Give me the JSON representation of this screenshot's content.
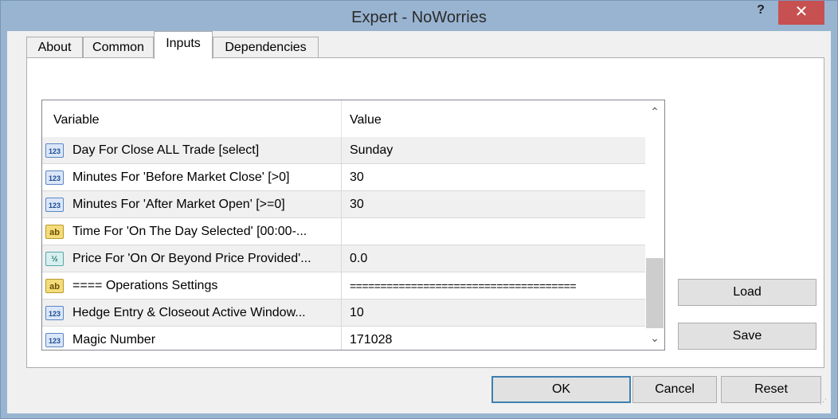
{
  "window": {
    "title": "Expert - NoWorries",
    "help_label": "?",
    "close_label": "✕"
  },
  "tabs": [
    {
      "label": "About",
      "active": false
    },
    {
      "label": "Common",
      "active": false
    },
    {
      "label": "Inputs",
      "active": true
    },
    {
      "label": "Dependencies",
      "active": false
    }
  ],
  "grid": {
    "columns": [
      "Variable",
      "Value"
    ],
    "rows": [
      {
        "icon": "integer-type-icon",
        "icon_text": "123",
        "variable": "Day For Close ALL Trade [select]",
        "value": "Sunday"
      },
      {
        "icon": "integer-type-icon",
        "icon_text": "123",
        "variable": "Minutes For 'Before Market Close' [>0]",
        "value": "30"
      },
      {
        "icon": "integer-type-icon",
        "icon_text": "123",
        "variable": "Minutes For 'After Market Open' [>=0]",
        "value": "30"
      },
      {
        "icon": "string-type-icon",
        "icon_text": "ab",
        "variable": "Time For 'On The Day Selected' [00:00-...",
        "value": ""
      },
      {
        "icon": "double-type-icon",
        "icon_text": "½",
        "variable": "Price For 'On Or Beyond Price Provided'...",
        "value": "0.0"
      },
      {
        "icon": "string-type-icon",
        "icon_text": "ab",
        "variable": "==== Operations Settings",
        "value": "====================================="
      },
      {
        "icon": "integer-type-icon",
        "icon_text": "123",
        "variable": "Hedge Entry & Closeout Active Window...",
        "value": "10"
      },
      {
        "icon": "integer-type-icon",
        "icon_text": "123",
        "variable": "Magic Number",
        "value": "171028"
      }
    ],
    "scroll_up": "⌃",
    "scroll_down": "⌄"
  },
  "side_buttons": {
    "load": "Load",
    "save": "Save"
  },
  "footer_buttons": {
    "ok": "OK",
    "cancel": "Cancel",
    "reset": "Reset"
  },
  "colors": {
    "titlebar": "#99b4d1",
    "close": "#c75050",
    "row_alt": "#f0f0f0"
  }
}
